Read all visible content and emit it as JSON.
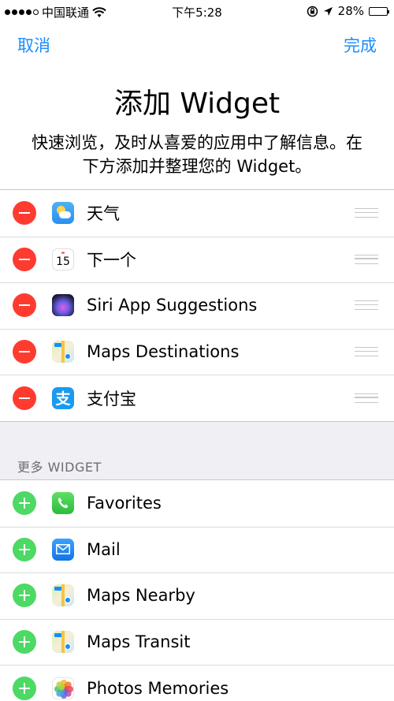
{
  "status_bar": {
    "carrier": "中国联通",
    "time": "下午5:28",
    "battery": "28%",
    "battery_level": 0.28
  },
  "nav": {
    "cancel_label": "取消",
    "done_label": "完成"
  },
  "header": {
    "title": "添加 Widget",
    "description": "快速浏览，及时从喜爱的应用中了解信息。在下方添加并整理您的 Widget。"
  },
  "active_widgets": [
    {
      "label": "天气",
      "icon": "weather-icon"
    },
    {
      "label": "下一个",
      "icon": "calendar-icon",
      "icon_text": "15"
    },
    {
      "label": "Siri App Suggestions",
      "icon": "siri-icon"
    },
    {
      "label": "Maps Destinations",
      "icon": "maps-icon"
    },
    {
      "label": "支付宝",
      "icon": "alipay-icon",
      "icon_text": "支"
    }
  ],
  "more_section": {
    "header": "更多 WIDGET",
    "items": [
      {
        "label": "Favorites",
        "icon": "phone-icon"
      },
      {
        "label": "Mail",
        "icon": "mail-icon"
      },
      {
        "label": "Maps Nearby",
        "icon": "maps-icon"
      },
      {
        "label": "Maps Transit",
        "icon": "maps-icon"
      },
      {
        "label": "Photos Memories",
        "icon": "photos-icon"
      }
    ]
  },
  "colors": {
    "accent": "#1a8cff",
    "remove": "#ff3b30",
    "add": "#4cd964"
  }
}
